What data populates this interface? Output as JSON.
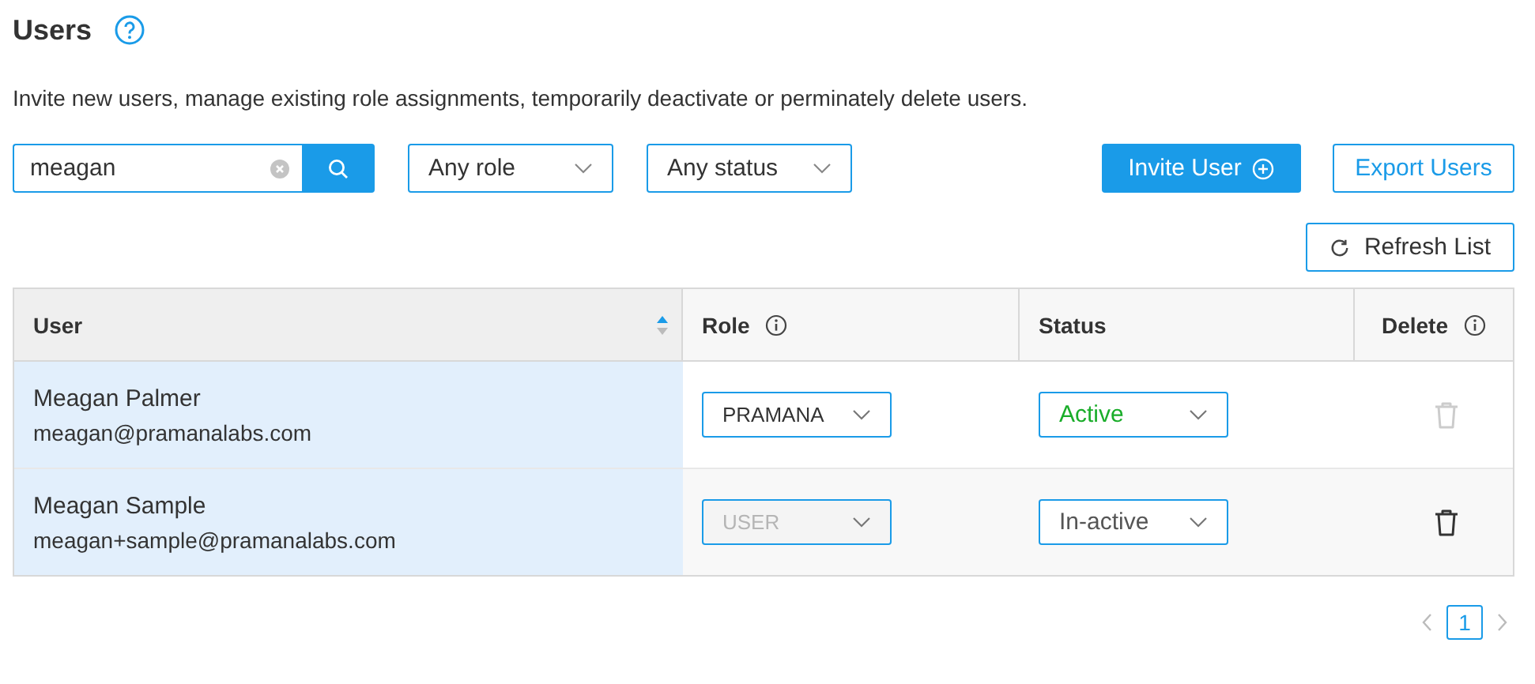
{
  "title": "Users",
  "description": "Invite new users, manage existing role assignments, temporarily deactivate or perminately delete users.",
  "search": {
    "value": "meagan"
  },
  "filters": [
    {
      "label": "Any role"
    },
    {
      "label": "Any status"
    }
  ],
  "actions": [
    {
      "label": "Invite User",
      "kind": "primary"
    },
    {
      "label": "Export Users",
      "kind": "outline"
    }
  ],
  "refresh": {
    "label": "Refresh List"
  },
  "table": {
    "columns": [
      {
        "label": "User",
        "sortable": true,
        "info": false
      },
      {
        "label": "Role",
        "sortable": false,
        "info": true
      },
      {
        "label": "Status",
        "sortable": false,
        "info": false
      },
      {
        "label": "Delete",
        "sortable": false,
        "info": true
      }
    ],
    "rows": [
      {
        "name": "Meagan Palmer",
        "email": "meagan@pramanalabs.com",
        "role": "PRAMANA",
        "role_disabled": false,
        "status": {
          "label": "Active",
          "color": "#1aad2a"
        },
        "delete_disabled": true
      },
      {
        "name": "Meagan Sample",
        "email": "meagan+sample@pramanalabs.com",
        "role": "USER",
        "role_disabled": true,
        "status": {
          "label": "In-active",
          "color": "#555555"
        },
        "delete_disabled": false
      }
    ]
  },
  "pagination": {
    "pages": [
      {
        "label": "1",
        "selected": true
      }
    ]
  }
}
